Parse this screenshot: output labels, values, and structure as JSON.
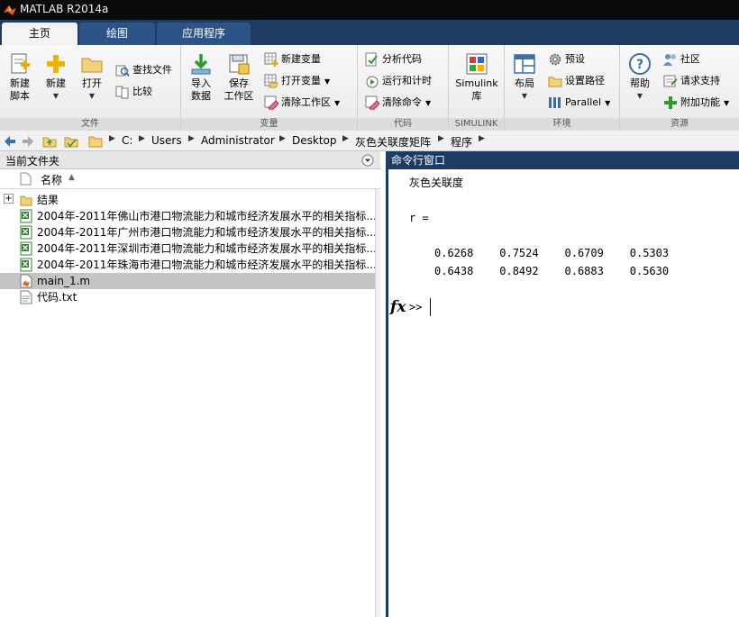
{
  "window": {
    "title": "MATLAB R2014a"
  },
  "tabs": [
    {
      "label": "主页",
      "active": true
    },
    {
      "label": "绘图",
      "active": false
    },
    {
      "label": "应用程序",
      "active": false
    }
  ],
  "ribbon": {
    "file_group": {
      "label": "文件",
      "new_script": "新建\n脚本",
      "new": "新建",
      "open": "打开",
      "find_files": "查找文件",
      "compare": "比较"
    },
    "variable_group": {
      "label": "变量",
      "import_data": "导入\n数据",
      "save_workspace": "保存\n工作区",
      "new_variable": "新建变量",
      "open_variable": "打开变量",
      "clear_workspace": "清除工作区"
    },
    "code_group": {
      "label": "代码",
      "analyze_code": "分析代码",
      "run_and_time": "运行和计时",
      "clear_commands": "清除命令"
    },
    "simulink_group": {
      "label": "SIMULINK",
      "simulink_library": "Simulink\n库"
    },
    "environment_group": {
      "label": "环境",
      "layout": "布局",
      "preferences": "预设",
      "set_path": "设置路径",
      "parallel": "Parallel"
    },
    "resources_group": {
      "label": "资源",
      "help": "帮助",
      "community": "社区",
      "request_support": "请求支持",
      "add_ons": "附加功能"
    }
  },
  "address": {
    "crumbs": [
      "C:",
      "Users",
      "Administrator",
      "Desktop",
      "灰色关联度矩阵",
      "程序"
    ]
  },
  "file_browser": {
    "title": "当前文件夹",
    "column_name": "名称",
    "items": [
      {
        "name": "结果",
        "type": "folder"
      },
      {
        "name": "2004年-2011年佛山市港口物流能力和城市经济发展水平的相关指标...",
        "type": "xls"
      },
      {
        "name": "2004年-2011年广州市港口物流能力和城市经济发展水平的相关指标...",
        "type": "xls"
      },
      {
        "name": "2004年-2011年深圳市港口物流能力和城市经济发展水平的相关指标...",
        "type": "xls"
      },
      {
        "name": "2004年-2011年珠海市港口物流能力和城市经济发展水平的相关指标...",
        "type": "xls"
      },
      {
        "name": "main_1.m",
        "type": "m",
        "selected": true
      },
      {
        "name": "代码.txt",
        "type": "txt"
      }
    ]
  },
  "command_window": {
    "title": "命令行窗口",
    "lines": {
      "heading": "灰色关联度",
      "r_label": "r =",
      "row1": "0.6268    0.7524    0.6709    0.5303",
      "row2": "0.6438    0.8492    0.6883    0.5630"
    },
    "fx_glyph": "fx",
    "prompt": ">>"
  },
  "colors": {
    "accent": "#1c3c63",
    "tab_inactive": "#2c5486",
    "selection": "#c4c4c4"
  }
}
